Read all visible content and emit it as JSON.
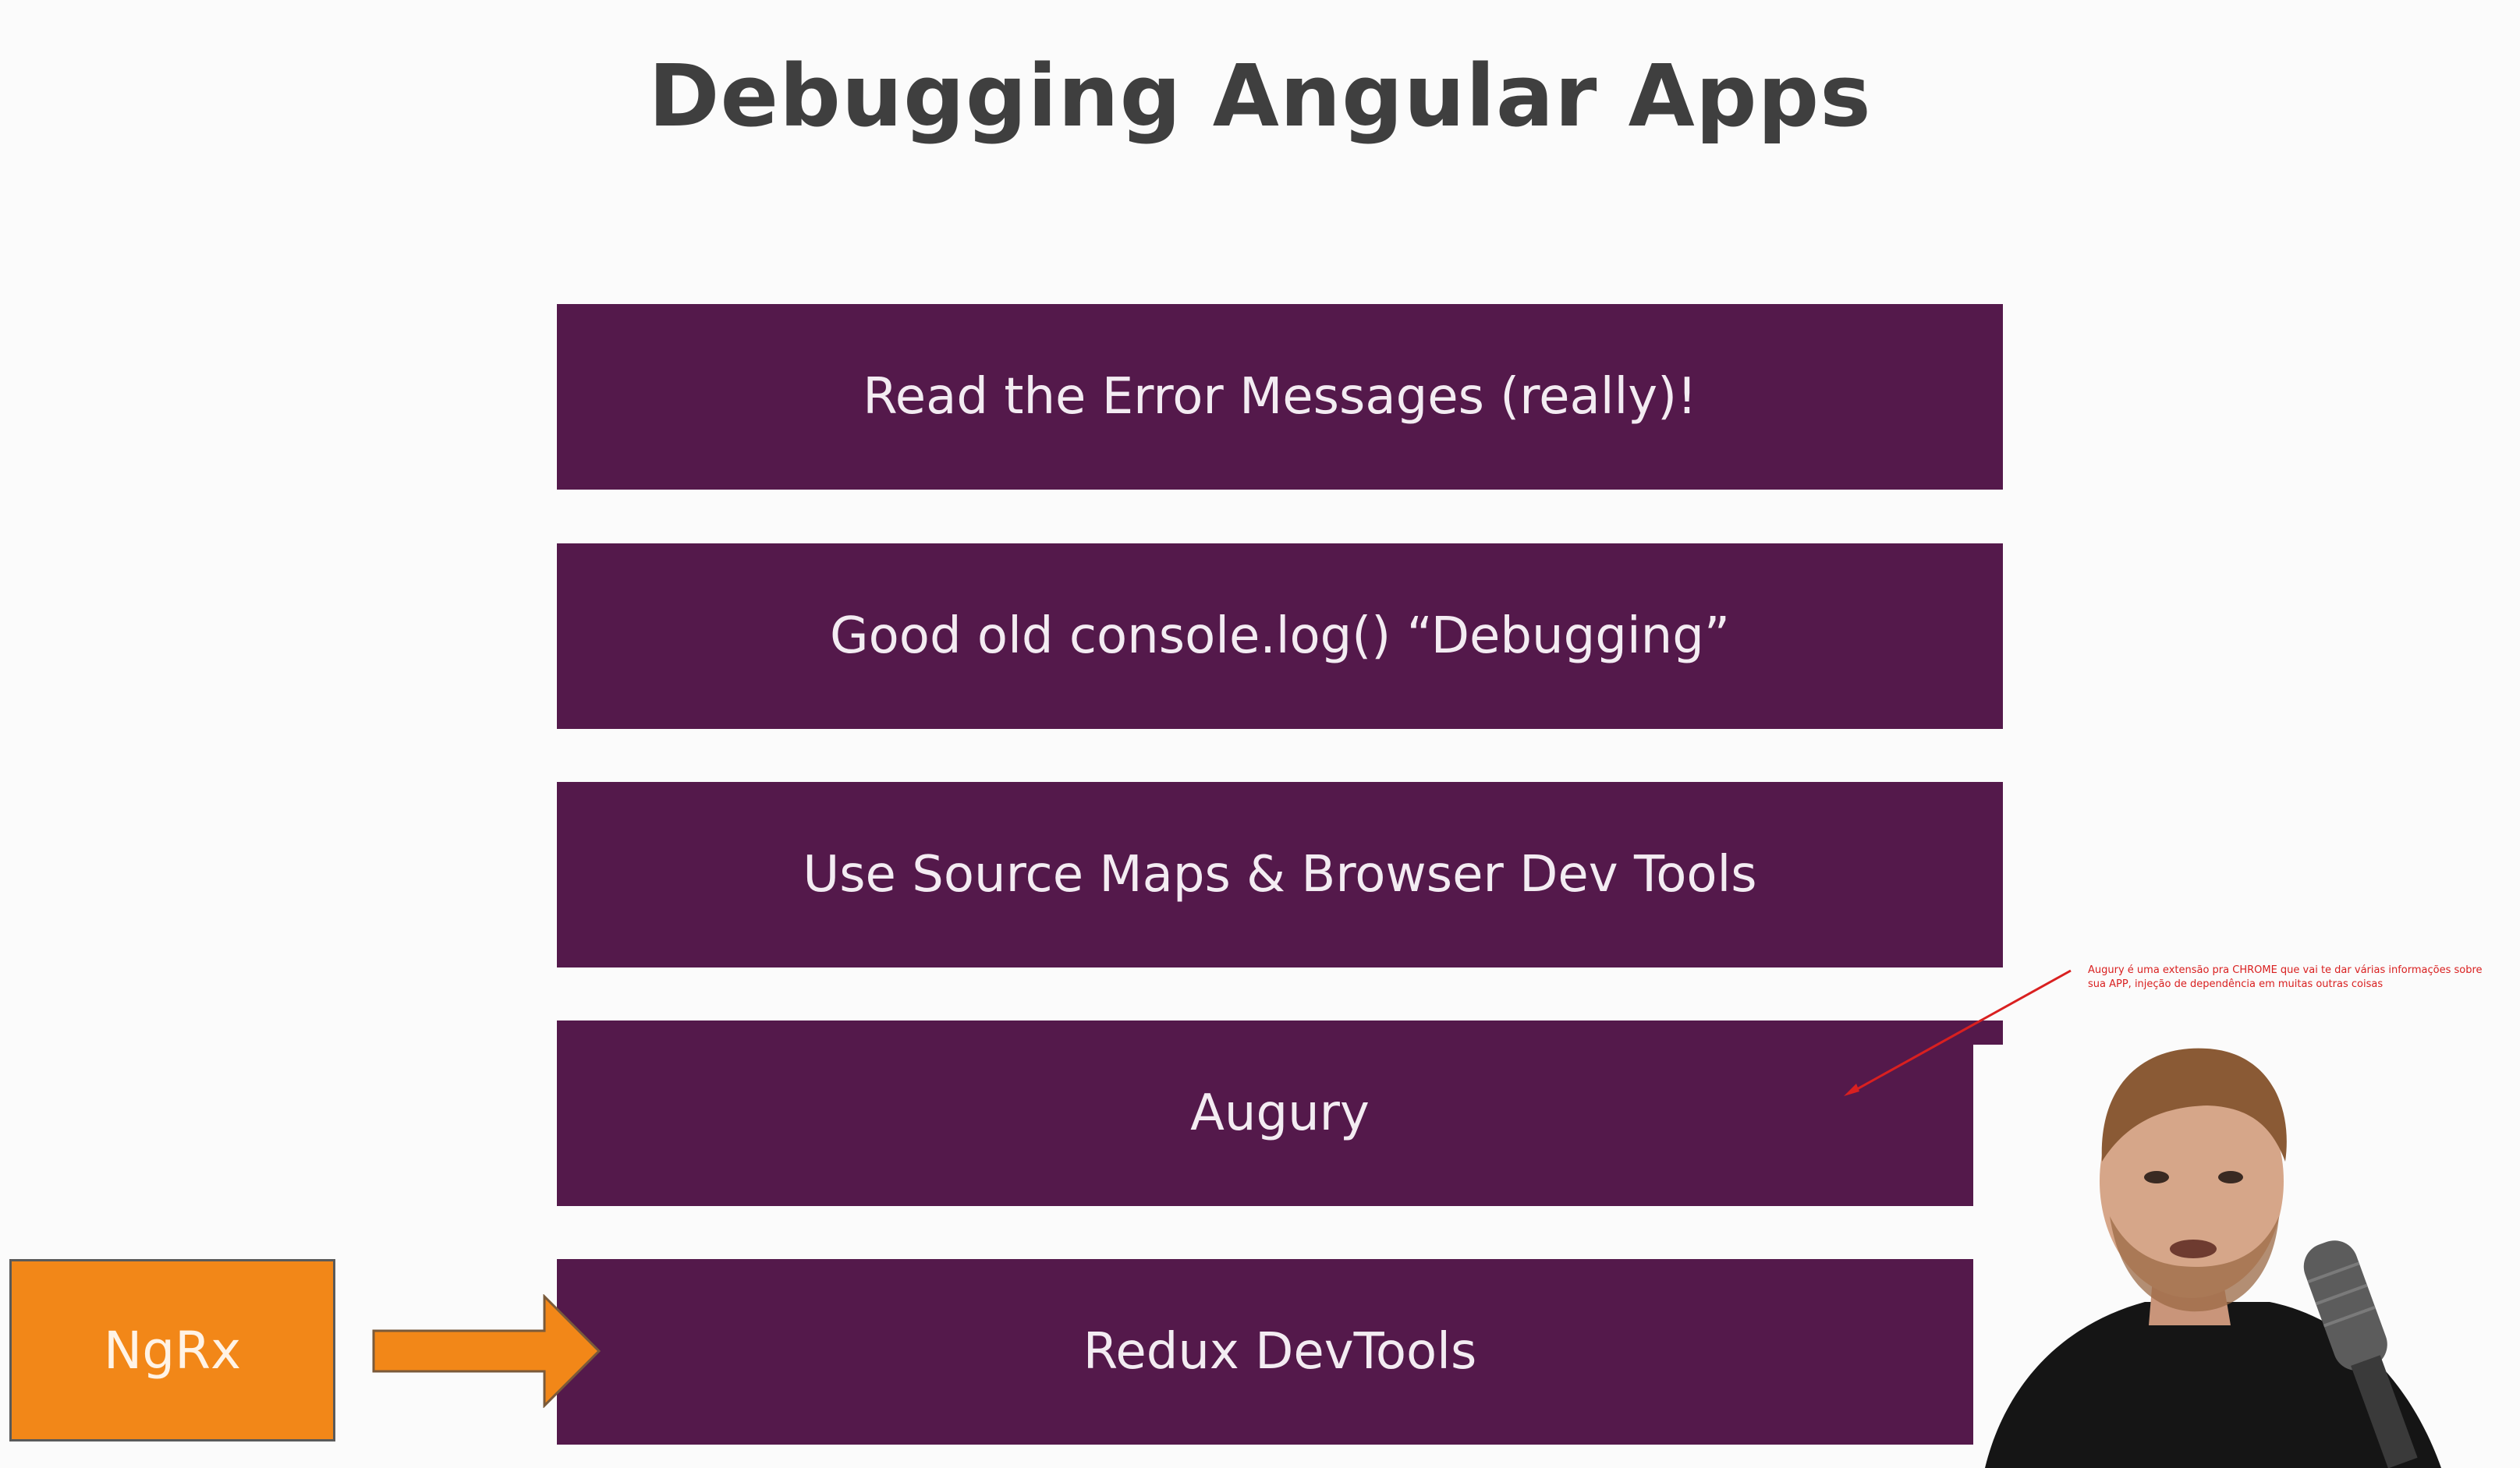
{
  "slide": {
    "title": "Debugging Angular Apps",
    "items": [
      {
        "label": "Read the Error Messages (really)!"
      },
      {
        "label": "Good old console.log() “Debugging”"
      },
      {
        "label": "Use Source Maps & Browser Dev Tools"
      },
      {
        "label": "Augury"
      },
      {
        "label": "Redux DevTools"
      }
    ],
    "side_box": {
      "label": "NgRx"
    },
    "annotation": {
      "text": "Augury é uma extensão pra CHROME que vai te dar várias informações sobre sua APP, injeção de dependência em muitas outras coisas"
    }
  },
  "colors": {
    "bar": "#54194b",
    "bar_text": "#f3ecf2",
    "title": "#3f3f3f",
    "orange": "#f28718",
    "annotation": "#d92020",
    "background": "#fbfbfb"
  }
}
